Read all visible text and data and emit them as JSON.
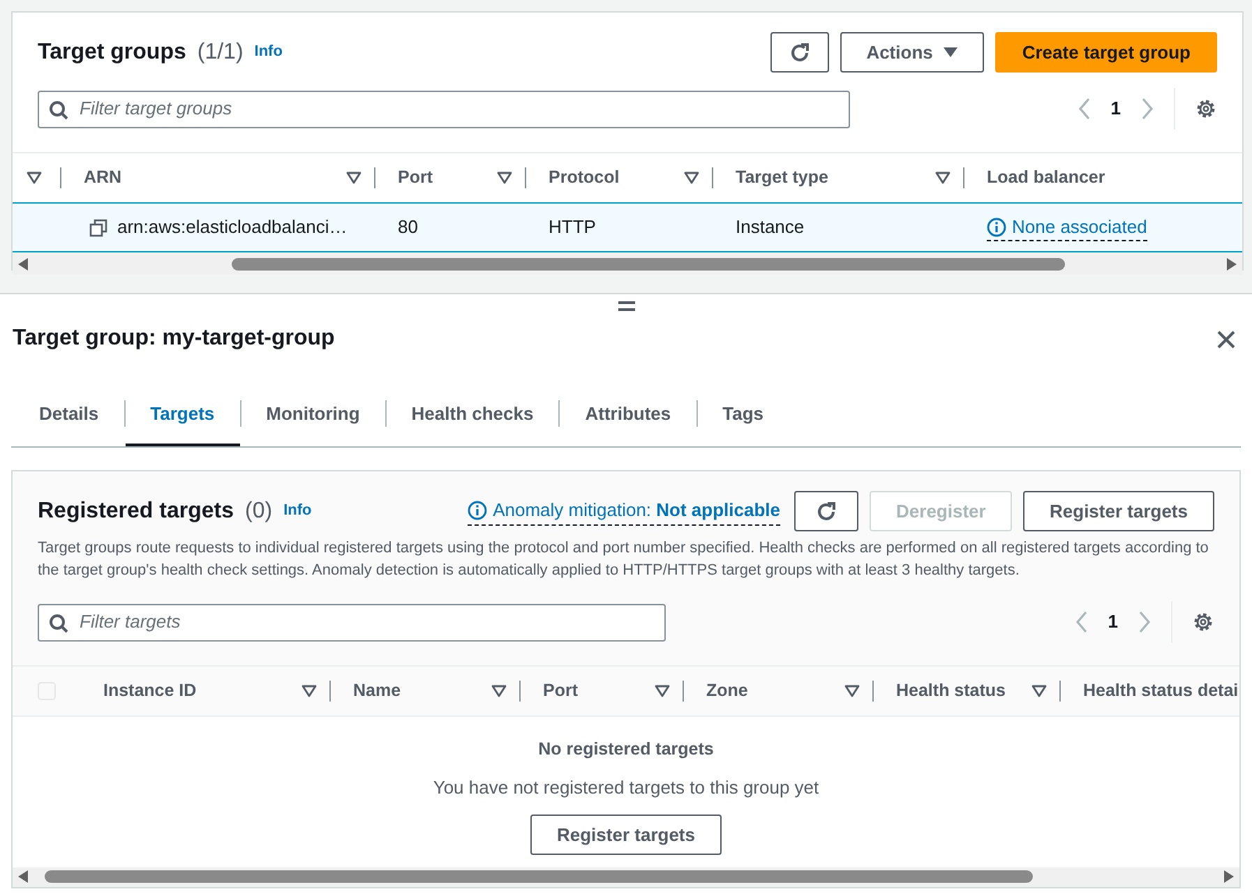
{
  "target_groups": {
    "title": "Target groups",
    "count": "(1/1)",
    "info": "Info",
    "actions": "Actions",
    "create": "Create target group",
    "filter": {
      "placeholder": "Filter target groups"
    },
    "page": "1",
    "columns": [
      "ARN",
      "Port",
      "Protocol",
      "Target type",
      "Load balancer"
    ],
    "rows": [
      {
        "selected": true,
        "arn": "arn:aws:elasticloadbalanci…",
        "port": "80",
        "protocol": "HTTP",
        "target_type": "Instance",
        "load_balancer": "None associated"
      }
    ]
  },
  "detail": {
    "title": "Target group: my-target-group",
    "tabs": [
      {
        "label": "Details",
        "selected": false
      },
      {
        "label": "Targets",
        "selected": true
      },
      {
        "label": "Monitoring",
        "selected": false
      },
      {
        "label": "Health checks",
        "selected": false
      },
      {
        "label": "Attributes",
        "selected": false
      },
      {
        "label": "Tags",
        "selected": false
      }
    ],
    "registered": {
      "title": "Registered targets",
      "count": "(0)",
      "info": "Info",
      "anomaly": "Anomaly mitigation: **Not applicable**",
      "buttons": [
        {
          "label": "Deregister",
          "disabled": true
        },
        {
          "label": "Register targets",
          "disabled": false
        }
      ],
      "description": "Target groups route requests to individual registered targets using the protocol and port number specified. Health checks are performed on all registered targets according to the target group's health check settings. Anomaly detection is automatically applied to HTTP/HTTPS target groups with at least 3 healthy targets.",
      "filter": {
        "placeholder": "Filter targets"
      },
      "page": "1",
      "select_all": {
        "checked": false,
        "disabled": true
      },
      "columns": [
        "Instance ID",
        "Name",
        "Port",
        "Zone",
        "Health status",
        "Health status detai"
      ],
      "empty_title": "No registered targets",
      "empty_text": "You have not registered targets to this group yet",
      "empty_button": "Register targets"
    }
  }
}
